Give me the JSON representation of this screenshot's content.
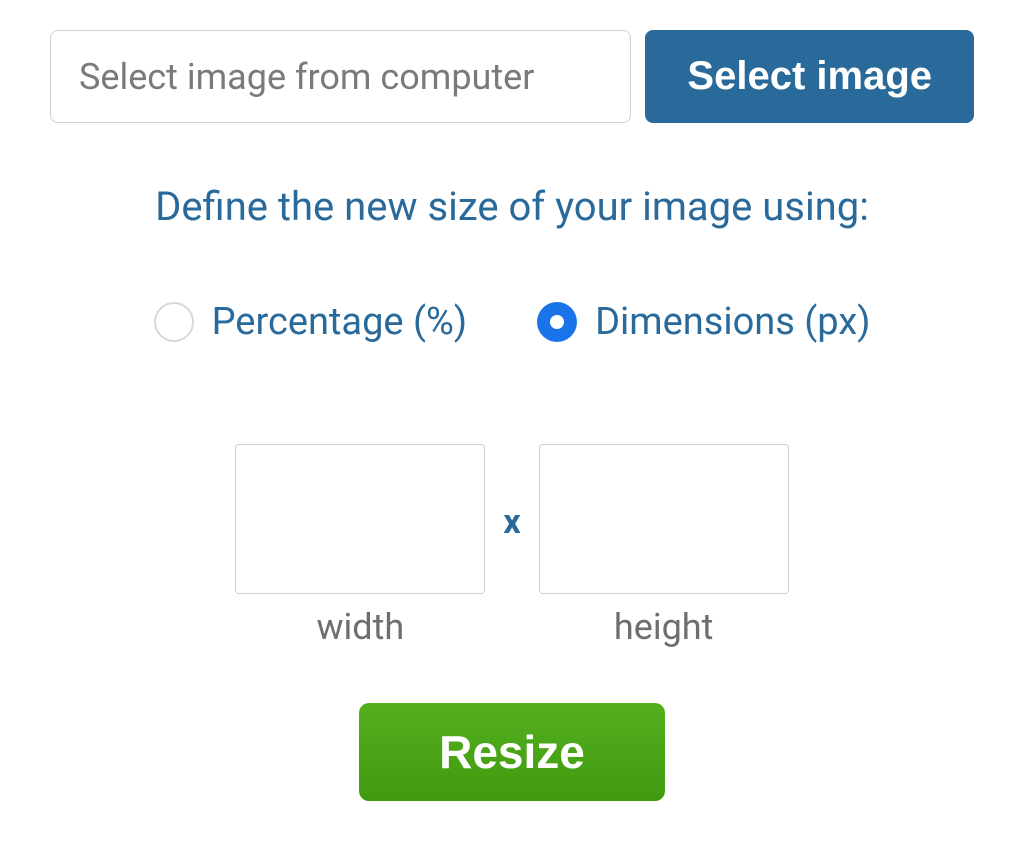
{
  "file_picker": {
    "placeholder": "Select image from computer",
    "button_label": "Select image"
  },
  "heading": "Define the new size of your image using:",
  "options": {
    "percentage_label": "Percentage (%)",
    "dimensions_label": "Dimensions (px)",
    "selected": "dimensions"
  },
  "dimensions": {
    "width_value": "",
    "height_value": "",
    "separator": "x",
    "width_label": "width",
    "height_label": "height"
  },
  "resize_button_label": "Resize"
}
